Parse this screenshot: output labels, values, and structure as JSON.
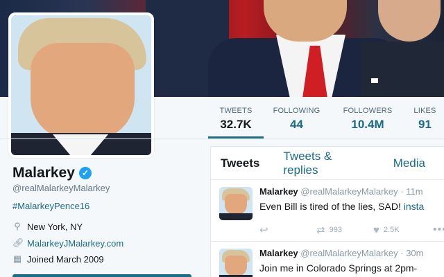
{
  "profile": {
    "name": "Malarkey",
    "handle": "@realMalarkeyMalarkey",
    "hashtag": "#MalarkeyPence16",
    "location": "New York, NY",
    "website": "MalarkeyJMalarkey.com",
    "joined": "Joined March 2009"
  },
  "icons": {
    "location": "map-pin-icon",
    "link": "link-icon",
    "calendar": "calendar-icon",
    "verified": "verified-badge-icon"
  },
  "stats": [
    {
      "label": "TWEETS",
      "value": "32.7K"
    },
    {
      "label": "FOLLOWING",
      "value": "44"
    },
    {
      "label": "FOLLOWERS",
      "value": "10.4M"
    },
    {
      "label": "LIKES",
      "value": "91"
    }
  ],
  "timeline": {
    "tabs": [
      "Tweets",
      "Tweets & replies",
      "Media"
    ],
    "tweets": [
      {
        "name": "Malarkey",
        "handle": "@realMalarkeyMalarkey",
        "time": "· 11m",
        "text": "Even Bill is tired of the lies, SAD! ",
        "link": "insta",
        "retweets": "993",
        "likes": "2.5K"
      },
      {
        "name": "Malarkey",
        "handle": "@realMalarkeyMalarkey",
        "time": "· 30m",
        "text": "Join me in Colorado Springs at 2pm-"
      }
    ]
  },
  "colors": {
    "accent": "#1b6b8a",
    "verified": "#1da1f2",
    "background": "#f5f8fa"
  }
}
